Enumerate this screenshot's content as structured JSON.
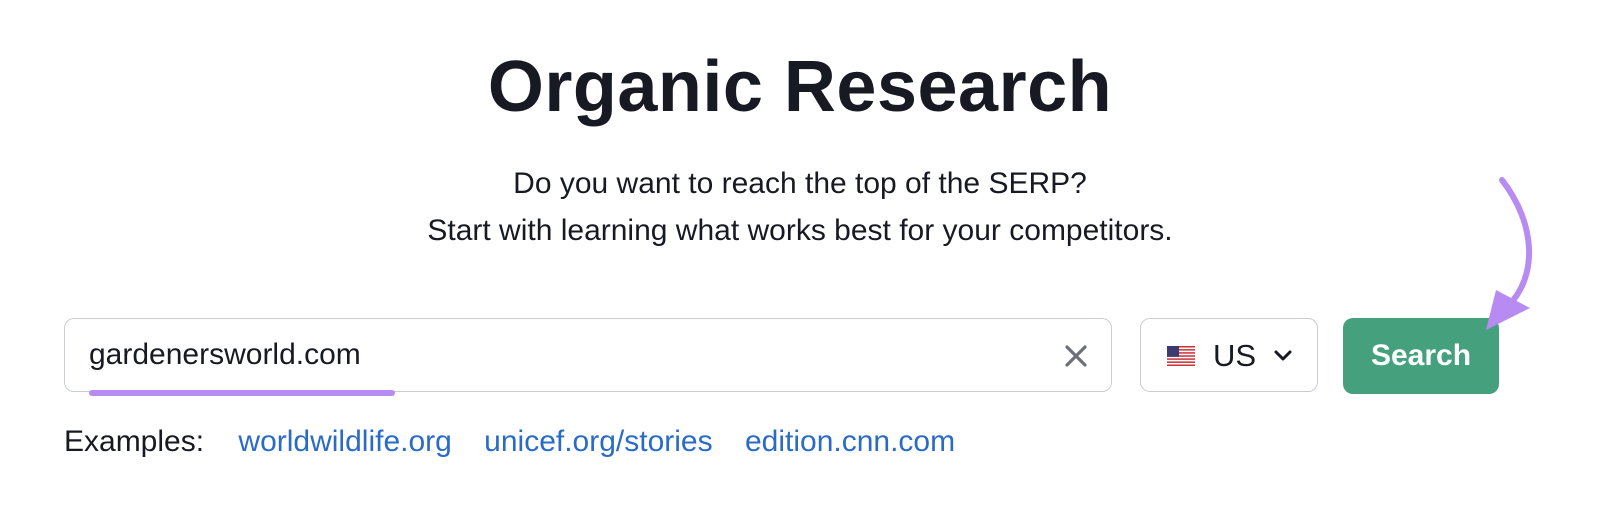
{
  "header": {
    "title": "Organic Research",
    "subtitle_line1": "Do you want to reach the top of the SERP?",
    "subtitle_line2": "Start with learning what works best for your competitors."
  },
  "search": {
    "value": "gardenersworld.com",
    "clear_icon": "close-icon"
  },
  "database": {
    "flag_icon": "us-flag-icon",
    "label": "US",
    "chevron_icon": "chevron-down-icon"
  },
  "search_button": {
    "label": "Search"
  },
  "examples": {
    "label": "Examples:",
    "links": [
      "worldwildlife.org",
      "unicef.org/stories",
      "edition.cnn.com"
    ]
  },
  "colors": {
    "accent_green": "#45a17d",
    "link_blue": "#2a6bc8",
    "highlight_purple": "#b78bf1",
    "text_dark": "#171a22"
  }
}
